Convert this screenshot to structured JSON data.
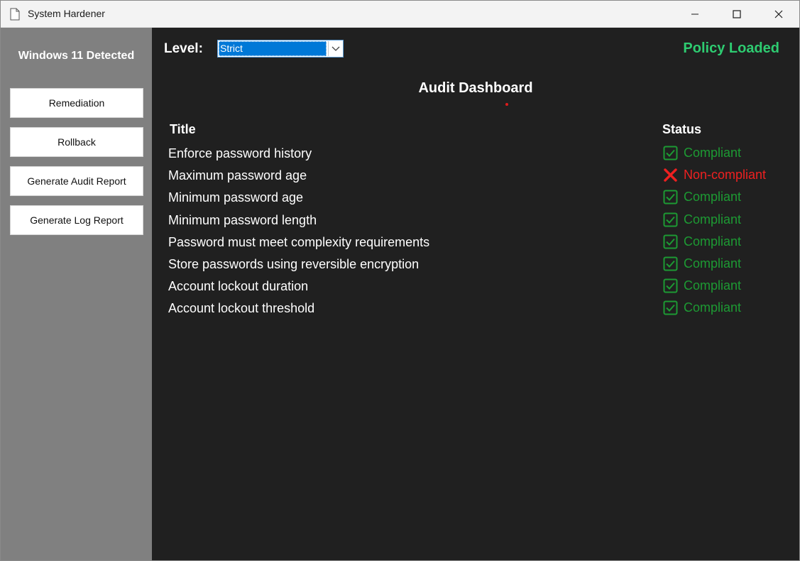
{
  "window": {
    "title": "System Hardener"
  },
  "sidebar": {
    "os_label": "Windows 11 Detected",
    "buttons": [
      {
        "label": "Remediation"
      },
      {
        "label": "Rollback"
      },
      {
        "label": "Generate Audit Report"
      },
      {
        "label": "Generate Log Report"
      }
    ]
  },
  "toolbar": {
    "level_label": "Level:",
    "level_value": "Strict",
    "policy_status": "Policy Loaded"
  },
  "dashboard": {
    "title": "Audit Dashboard",
    "columns": {
      "title": "Title",
      "status": "Status"
    },
    "rows": [
      {
        "title": "Enforce password history",
        "status": "Compliant",
        "state": "ok"
      },
      {
        "title": "Maximum password age",
        "status": "Non-compliant",
        "state": "bad"
      },
      {
        "title": "Minimum password age",
        "status": "Compliant",
        "state": "ok"
      },
      {
        "title": "Minimum password length",
        "status": "Compliant",
        "state": "ok"
      },
      {
        "title": "Password must meet complexity requirements",
        "status": "Compliant",
        "state": "ok"
      },
      {
        "title": "Store passwords using reversible encryption",
        "status": "Compliant",
        "state": "ok"
      },
      {
        "title": "Account lockout duration",
        "status": "Compliant",
        "state": "ok"
      },
      {
        "title": "Account lockout threshold",
        "status": "Compliant",
        "state": "ok"
      }
    ]
  },
  "colors": {
    "compliant": "#1d9a33",
    "non_compliant": "#ee2020",
    "policy_loaded": "#2ecc71",
    "sidebar_bg": "#808080",
    "main_bg": "#202020"
  },
  "icons": {
    "compliant": "check-box-icon",
    "non_compliant": "x-mark-icon"
  }
}
